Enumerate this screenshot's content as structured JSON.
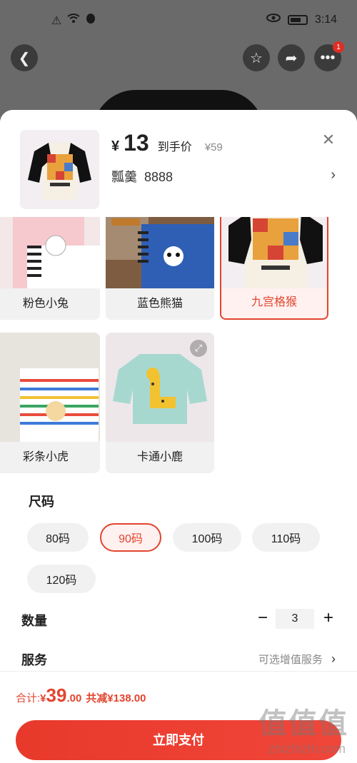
{
  "status_bar": {
    "time": "3:14",
    "icons": [
      "alert-icon",
      "wifi-icon",
      "penguin-icon",
      "eye-icon",
      "battery-icon"
    ]
  },
  "top_nav": {
    "back_icon": "chevron-left-icon",
    "icons": [
      "star-icon",
      "share-icon",
      "more-icon"
    ],
    "more_badge": "1"
  },
  "sku_header": {
    "currency": "¥",
    "price": "13",
    "price_tag": "到手价",
    "original_price": "¥59",
    "sku_text": "瓢羹  8888",
    "close_icon": "close-icon"
  },
  "styles": [
    {
      "label": "粉色小兔",
      "selected": false
    },
    {
      "label": "蓝色熊猫",
      "selected": false
    },
    {
      "label": "九宫格猴",
      "selected": true
    },
    {
      "label": "彩条小虎",
      "selected": false
    },
    {
      "label": "卡通小鹿",
      "selected": false
    }
  ],
  "style_labels_visible": {
    "s0": "粉色小兔",
    "s1": "蓝色熊猫",
    "s2": "九宫格猴",
    "s3": "彩条小虎",
    "s4": "卡通小鹿"
  },
  "size_section": {
    "title": "尺码",
    "options": [
      "80码",
      "90码",
      "100码",
      "110码",
      "120码"
    ],
    "selected": "90码"
  },
  "quantity": {
    "label": "数量",
    "minus": "−",
    "value": "3",
    "plus": "+"
  },
  "service": {
    "label": "服务",
    "link": "可选增值服务",
    "chevron": "›"
  },
  "footer": {
    "total_label": "合计: ",
    "currency": "¥",
    "total_int": "39",
    "total_dec": ".00",
    "reduce_text": "共减¥138.00",
    "pay_button": "立即支付",
    "watermark": "值值值",
    "watermark_sub": "zhizhizhi.com"
  },
  "colors": {
    "accent": "#e2452f",
    "pay_button": "#e8392b"
  }
}
